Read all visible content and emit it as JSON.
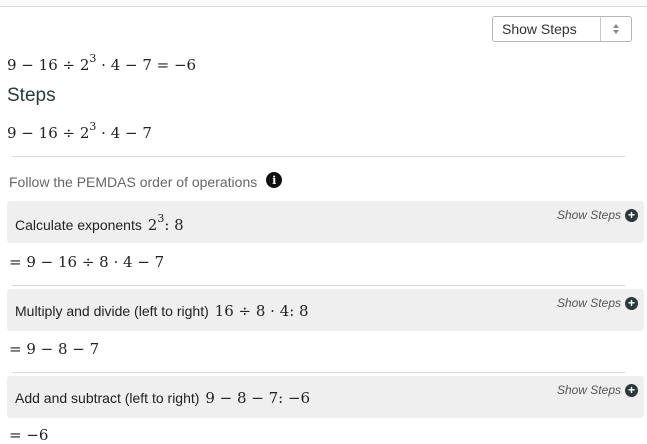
{
  "dropdown": {
    "selected": "Show Steps"
  },
  "result": {
    "expr_a": "9 − 16 ÷ 2",
    "exp": "3",
    "expr_b": " · 4 − 7 = −6"
  },
  "steps_heading": "Steps",
  "problem": {
    "expr_a": "9 − 16 ÷ 2",
    "exp": "3",
    "expr_b": " · 4 − 7"
  },
  "hint": "Follow the PEMDAS order of operations",
  "steps": [
    {
      "desc": "Calculate exponents",
      "math_a": "2",
      "math_exp": "3",
      "math_b": ":   8",
      "show_steps": "Show Steps",
      "result": "= 9 − 16 ÷ 8 · 4 − 7"
    },
    {
      "desc": "Multiply and divide (left to right)",
      "math": "16 ÷ 8 · 4:   8",
      "show_steps": "Show Steps",
      "result": "= 9 − 8 − 7"
    },
    {
      "desc": "Add and subtract (left to right)",
      "math": "9 − 8 − 7:   −6",
      "show_steps": "Show Steps",
      "result": "= −6"
    }
  ]
}
